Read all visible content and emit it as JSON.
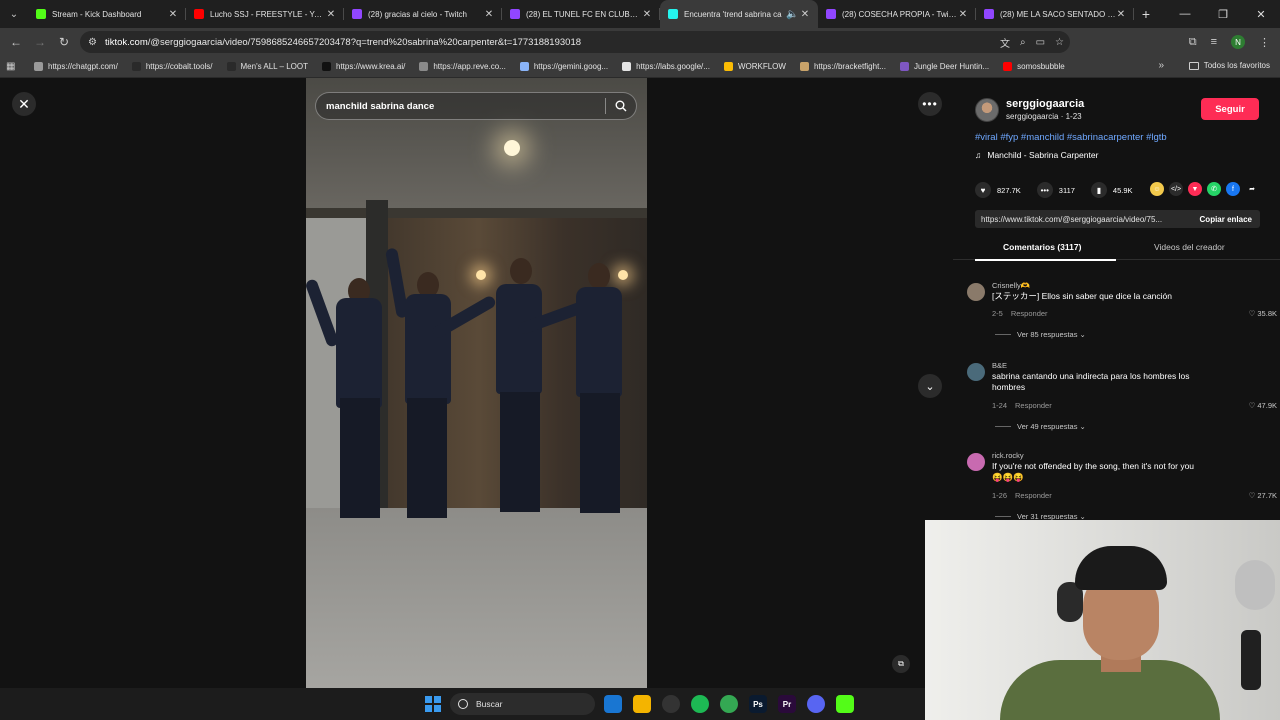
{
  "browser": {
    "tabs": [
      {
        "title": "Stream - Kick Dashboard",
        "favicon_color": "#53fc18",
        "active": false
      },
      {
        "title": "Lucho SSJ - FREESTYLE - YouTube",
        "favicon_color": "#ff0000",
        "active": false
      },
      {
        "title": "(28) gracias al cielo - Twitch",
        "favicon_color": "#9146ff",
        "active": false
      },
      {
        "title": "(28) EL TUNEL FC EN CLUBES P",
        "favicon_color": "#9146ff",
        "active": false
      },
      {
        "title": "Encuentra 'trend sabrina ca",
        "favicon_color": "#25f4ee",
        "active": true
      },
      {
        "title": "(28) COSECHA PROPIA - Twitch",
        "favicon_color": "#9146ff",
        "active": false
      },
      {
        "title": "(28) ME LA SACO SENTADO - T",
        "favicon_color": "#9146ff",
        "active": false
      }
    ],
    "url_host": "tiktok.com",
    "url_path": "/@serggiogaarcia/video/7598685246657203478?q=trend%20sabrina%20carpenter&t=1773188193018",
    "bookmarks": [
      {
        "label": "https://chatgpt.com/",
        "color": "#9a9a9a"
      },
      {
        "label": "https://cobalt.tools/",
        "color": "#2a2a2a"
      },
      {
        "label": "Men's ALL – LOOT",
        "color": "#2a2a2a"
      },
      {
        "label": "https://www.krea.ai/",
        "color": "#111111"
      },
      {
        "label": "https://app.reve.co...",
        "color": "#8a8a8a"
      },
      {
        "label": "https://gemini.goog...",
        "color": "#8ab4f8"
      },
      {
        "label": "https://labs.google/...",
        "color": "#e3e3e3"
      },
      {
        "label": "WORKFLOW",
        "color": "#fbbc04"
      },
      {
        "label": "https://bracketfight...",
        "color": "#c9a36a"
      },
      {
        "label": "Jungle Deer Huntin...",
        "color": "#7e57c2"
      },
      {
        "label": "somosbubble",
        "color": "#ff0000"
      }
    ],
    "all_bookmarks": "Todos los favoritos",
    "profile_letter": "N"
  },
  "video": {
    "search_text": "manchild sabrina dance"
  },
  "creator": {
    "username": "serggiogaarcia",
    "subline": "serggiogaarcia · 1-23",
    "follow_label": "Seguir",
    "hashtags": "#viral #fyp #manchild #sabrinacarpenter #lgtb",
    "music": "Manchild - Sabrina Carpenter",
    "likes": "827.7K",
    "comments": "3117",
    "saves": "45.9K",
    "share_link": "https://www.tiktok.com/@serggiogaarcia/video/75...",
    "copy_label": "Copiar enlace",
    "tab_comments": "Comentarios (3117)",
    "tab_videos": "Videos del creador"
  },
  "comments": [
    {
      "user": "Crisnelly🫶",
      "text": "[ステッカー] Ellos sin saber que dice la canción",
      "date": "2-5",
      "reply": "Responder",
      "likes": "35.8K",
      "more": "Ver 85 respuestas",
      "avatar_color": "#8a7a6a"
    },
    {
      "user": "B&E",
      "text": "sabrina cantando una indirecta para los hombres los hombres",
      "date": "1-24",
      "reply": "Responder",
      "likes": "47.9K",
      "more": "Ver 49 respuestas",
      "avatar_color": "#4a6a7a"
    },
    {
      "user": "rick.rocky",
      "text": "If you're not offended by the song, then it's not for you 😝😝😝",
      "date": "1-26",
      "reply": "Responder",
      "likes": "27.7K",
      "more": "Ver 31 respuestas",
      "avatar_color": "#c86ab0"
    }
  ],
  "taskbar": {
    "search_label": "Buscar",
    "apps": [
      {
        "name": "outlook",
        "label": "",
        "color": "#1976d2"
      },
      {
        "name": "explorer",
        "label": "",
        "color": "#f4b400"
      },
      {
        "name": "github",
        "label": "",
        "color": "#333333"
      },
      {
        "name": "spotify",
        "label": "",
        "color": "#1db954"
      },
      {
        "name": "chrome",
        "label": "",
        "color": "#34a853"
      },
      {
        "name": "photoshop",
        "label": "Ps",
        "color": "#0a1a2f"
      },
      {
        "name": "premiere",
        "label": "Pr",
        "color": "#2a0a3a"
      },
      {
        "name": "discord",
        "label": "",
        "color": "#5865f2"
      },
      {
        "name": "kick",
        "label": "",
        "color": "#53fc18"
      }
    ]
  }
}
